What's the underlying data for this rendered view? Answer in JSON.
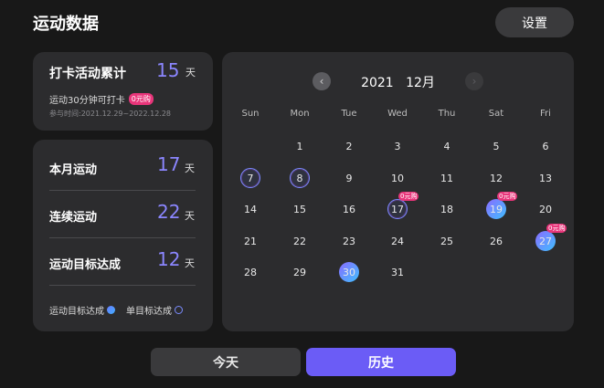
{
  "header": {
    "title": "运动数据",
    "settings_label": "设置"
  },
  "checkin": {
    "label": "打卡活动累计",
    "count": "15",
    "unit": "天",
    "sub_text": "运动30分钟可打卡",
    "badge": "0元购",
    "period": "参与时间:2021.12.29~2022.12.28"
  },
  "stats": [
    {
      "label": "本月运动",
      "value": "17",
      "unit": "天"
    },
    {
      "label": "连续运动",
      "value": "22",
      "unit": "天"
    },
    {
      "label": "运动目标达成",
      "value": "12",
      "unit": "天"
    }
  ],
  "legend": {
    "filled": "运动目标达成",
    "ring": "单目标达成"
  },
  "calendar": {
    "year": "2021",
    "month": "12月",
    "weekdays": [
      "Sun",
      "Mon",
      "Tue",
      "Wed",
      "Thu",
      "Sat",
      "Fri"
    ],
    "weeks": [
      [
        null,
        "1",
        "2",
        "3",
        "4",
        "5",
        "6"
      ],
      [
        "7",
        "8",
        "9",
        "10",
        "11",
        "12",
        "13"
      ],
      [
        "14",
        "15",
        "16",
        "17",
        "18",
        "19",
        "20"
      ],
      [
        "21",
        "22",
        "23",
        "24",
        "25",
        "26",
        "27"
      ],
      [
        "28",
        "29",
        "30",
        "31",
        null,
        null,
        null
      ]
    ],
    "ring_days": [
      "7",
      "8",
      "17"
    ],
    "filled_days": [
      "19",
      "27",
      "30"
    ],
    "badge_days": [
      "17",
      "19",
      "27"
    ],
    "badge_text": "0元购"
  },
  "footer": {
    "today_label": "今天",
    "history_label": "历史"
  },
  "colors": {
    "accent": "#8b86ff",
    "primary_button": "#6b5cf6",
    "badge": "#e8357a"
  }
}
